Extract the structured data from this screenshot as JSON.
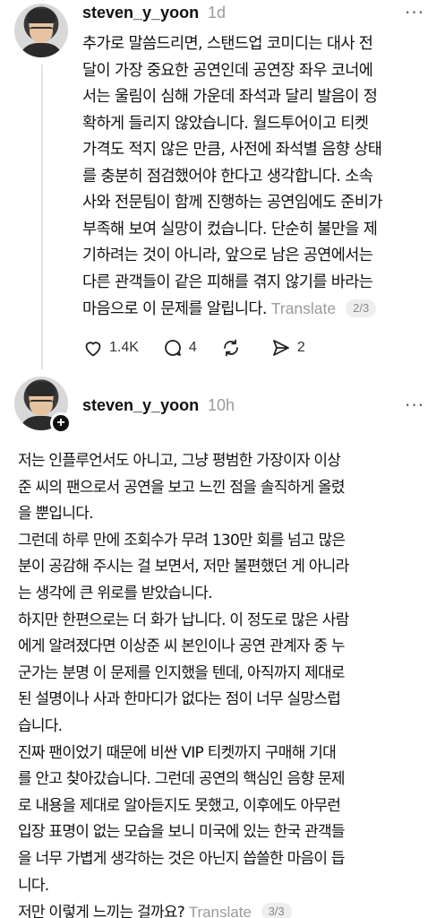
{
  "post1": {
    "username": "steven_y_yoon",
    "time": "1d",
    "more_label": "···",
    "lines": [
      "추가로 말씀드리면, 스탠드업 코미디는 대사 전",
      "달이 가장 중요한 공연인데 공연장 좌우 코너에",
      "서는 울림이 심해 가운데 좌석과 달리 발음이 정",
      "확하게 들리지 않았습니다. 월드투어이고 티켓",
      "가격도 적지 않은 만큼, 사전에 좌석별 음향 상태",
      "를 충분히 점검했어야 한다고 생각합니다. 소속",
      "사와 전문팀이 함께 진행하는 공연임에도 준비가",
      "부족해 보여 실망이 컸습니다. 단순히 불만을 제",
      "기하려는 것이 아니라, 앞으로 남은 공연에서는",
      "다른 관객들이 같은 피해를 겪지 않기를 바라는",
      "마음으로 이 문제를 알립니다."
    ],
    "translate_label": "Translate",
    "page_badge": "2/3",
    "likes": "1.4K",
    "comments": "4",
    "shares": "2"
  },
  "post2": {
    "username": "steven_y_yoon",
    "time": "10h",
    "more_label": "···",
    "plus_label": "+",
    "lines": [
      "저는 인플루언서도 아니고, 그냥 평범한 가장이자 이상",
      "준 씨의 팬으로서 공연을 보고 느낀 점을 솔직하게 올렸",
      "을 뿐입니다.",
      "그런데 하루 만에 조회수가 무려 130만 회를 넘고 많은",
      "분이 공감해 주시는 걸 보면서, 저만 불편했던 게 아니라",
      "는 생각에 큰 위로를 받았습니다.",
      "하지만 한편으로는 더 화가 납니다. 이 정도로 많은 사람",
      "에게 알려졌다면 이상준 씨 본인이나 공연 관계자 중 누",
      "군가는 분명 이 문제를 인지했을 텐데, 아직까지 제대로",
      "된 설명이나 사과 한마디가 없다는 점이 너무 실망스럽",
      "습니다.",
      "진짜 팬이었기 때문에 비싼 VIP 티켓까지 구매해 기대",
      "를 안고 찾아갔습니다. 그런데 공연의 핵심인 음향 문제",
      "로 내용을 제대로 알아듣지도 못했고, 이후에도 아무런",
      "입장 표명이 없는 모습을 보니 미국에 있는 한국 관객들",
      "을 너무 가볍게 생각하는 것은 아닌지 씁쓸한 마음이 듭",
      "니다.",
      "저만 이렇게 느끼는 걸까요?"
    ],
    "translate_label": "Translate",
    "page_badge": "3/3"
  }
}
